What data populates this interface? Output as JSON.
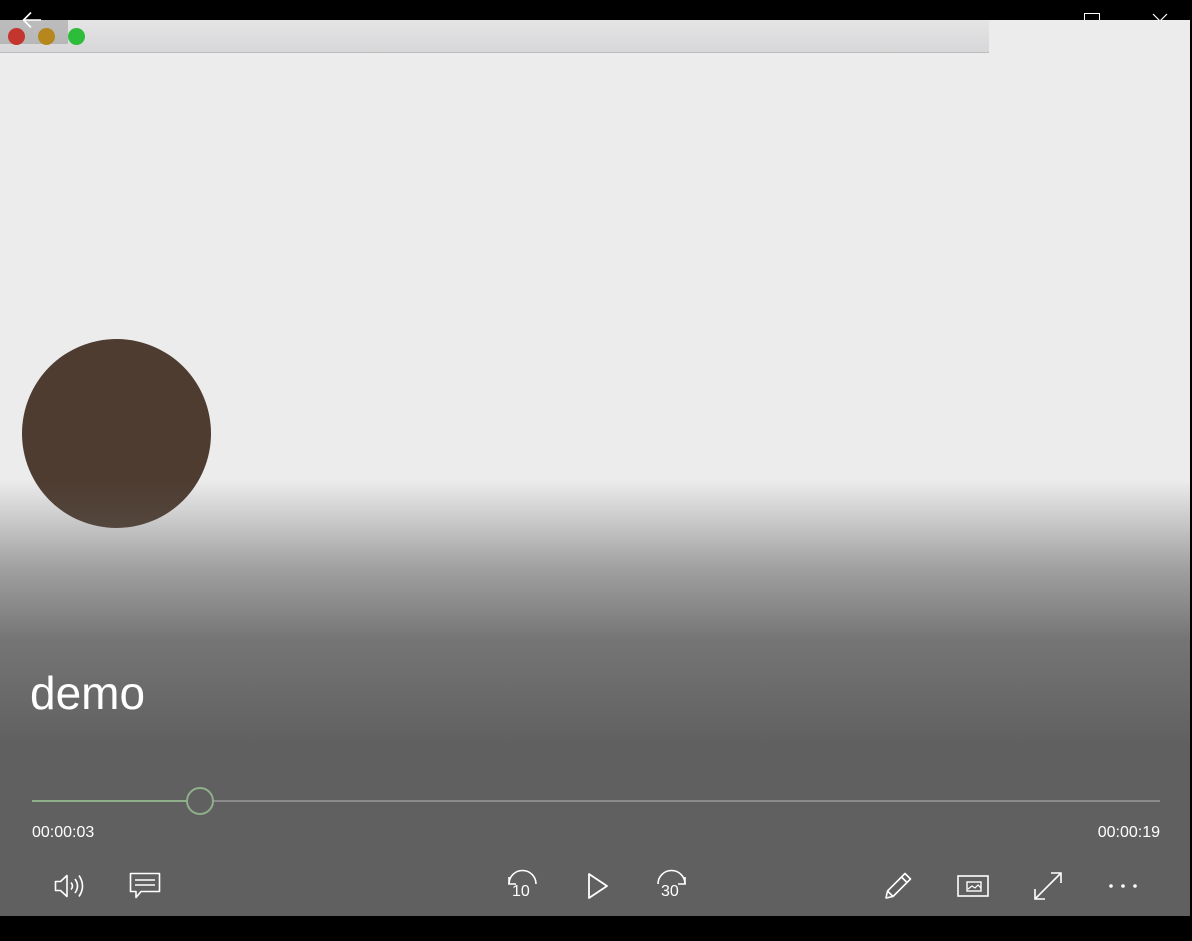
{
  "player": {
    "title": "demo",
    "current_time": "00:00:03",
    "total_time": "00:00:19",
    "progress": 0.149
  },
  "controls": {
    "rewind_seconds": "10",
    "forward_seconds": "30"
  },
  "colors": {
    "accent": "#8fae8a",
    "ball": "#4e3c30",
    "close_light": "#c3352e",
    "minimize_light": "#b5871c",
    "maximize_light": "#2dbd3b"
  },
  "icons": [
    "back-arrow-icon",
    "minimize-icon",
    "maximize-icon",
    "close-icon",
    "volume-icon",
    "subtitles-icon",
    "rewind-icon",
    "play-icon",
    "forward-icon",
    "edit-icon",
    "mini-view-icon",
    "fullscreen-icon",
    "more-icon"
  ]
}
